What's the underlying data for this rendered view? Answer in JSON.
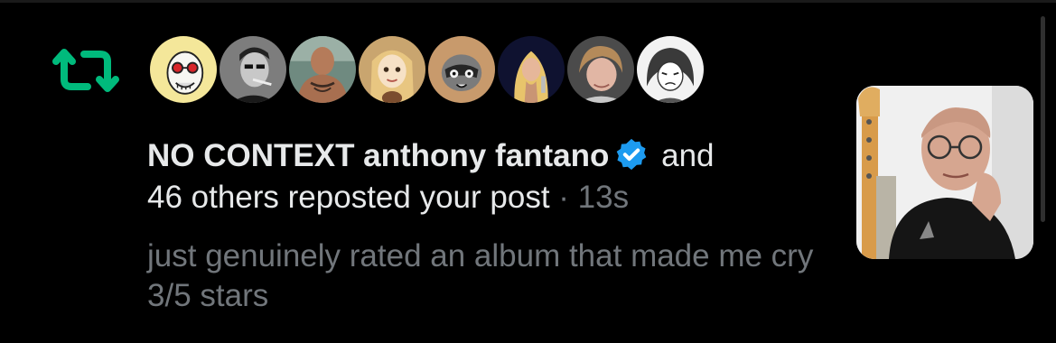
{
  "notification": {
    "type_icon": "repost-icon",
    "accent_color": "#00ba7c",
    "verified_color": "#1d9bf0",
    "avatar_icons": [
      "avatar-1",
      "avatar-2",
      "avatar-3",
      "avatar-4",
      "avatar-5",
      "avatar-6",
      "avatar-7",
      "avatar-8"
    ],
    "actor_name": "NO CONTEXT anthony fantano",
    "actor_verified": true,
    "joiner": "and",
    "others_text": "46 others reposted your post",
    "separator": " · ",
    "time": "13s",
    "post_text": "just genuinely rated an album that made me cry 3/5 stars"
  }
}
